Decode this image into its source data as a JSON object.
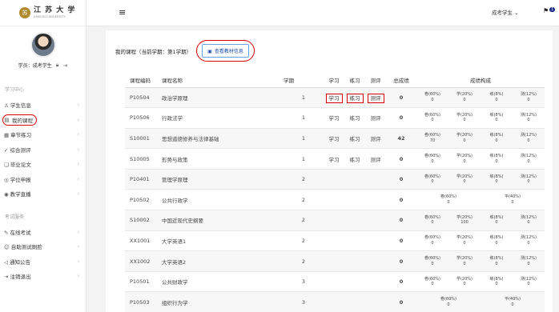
{
  "brand": {
    "logo_text": "江 苏 大 学",
    "logo_sub": "JIANGSU UNIVERSITY",
    "seal": "苏"
  },
  "profile": {
    "label": "学员：",
    "name": "成考学生"
  },
  "topbar": {
    "user": "成考学生",
    "badge": "1"
  },
  "sidebar": {
    "section1": "学习中心",
    "items1": [
      {
        "label": "学生信息",
        "icon": "user-icon"
      },
      {
        "label": "我的课程",
        "icon": "book-icon"
      },
      {
        "label": "章节练习",
        "icon": "doc-icon"
      },
      {
        "label": "综合测评",
        "icon": "check-icon"
      },
      {
        "label": "毕业论文",
        "icon": "paper-icon"
      },
      {
        "label": "学位申报",
        "icon": "degree-icon"
      },
      {
        "label": "教学直播",
        "icon": "live-icon"
      }
    ],
    "section2": "考试服务",
    "items2": [
      {
        "label": "在线考试",
        "icon": "edit-icon"
      },
      {
        "label": "自助测试刷脸",
        "icon": "face-icon"
      },
      {
        "label": "通知公告",
        "icon": "bell-icon"
      },
      {
        "label": "注销退出",
        "icon": "logout-icon"
      }
    ]
  },
  "main": {
    "title": "我的课程（当前学期：第1学期）",
    "textbook_button": "查看教材信息",
    "headers": [
      "课程编码",
      "课程名称",
      "学期",
      "学习",
      "练习",
      "测评",
      "总成绩",
      "成绩构成"
    ],
    "rows": [
      {
        "code": "P10504",
        "name": "政治学原理",
        "term": "1",
        "study": "学习",
        "practice": "练习",
        "exam": "测评",
        "total": "0",
        "scores": [
          [
            "卷(60%)",
            "0"
          ],
          [
            "学(20%)",
            "0"
          ],
          [
            "练(8%)",
            "0"
          ],
          [
            "测(12%)",
            "0"
          ]
        ]
      },
      {
        "code": "P10506",
        "name": "行政法学",
        "term": "1",
        "study": "学习",
        "practice": "练习",
        "exam": "测评",
        "total": "0",
        "scores": [
          [
            "卷(60%)",
            "0"
          ],
          [
            "学(20%)",
            "0"
          ],
          [
            "练(8%)",
            "0"
          ],
          [
            "测(12%)",
            "0"
          ]
        ]
      },
      {
        "code": "S10001",
        "name": "思想道德修养与法律基础",
        "term": "1",
        "study": "学习",
        "practice": "练习",
        "exam": "测评",
        "total": "42",
        "scores": [
          [
            "卷(60%)",
            "70"
          ],
          [
            "学(20%)",
            "0"
          ],
          [
            "练(8%)",
            "0"
          ],
          [
            "测(12%)",
            "0"
          ]
        ]
      },
      {
        "code": "S10005",
        "name": "形势与政策",
        "term": "1",
        "study": "学习",
        "practice": "练习",
        "exam": "测评",
        "total": "0",
        "scores": [
          [
            "卷(60%)",
            "0"
          ],
          [
            "学(20%)",
            "0"
          ],
          [
            "练(8%)",
            "0"
          ],
          [
            "测(12%)",
            "0"
          ]
        ]
      },
      {
        "code": "P10401",
        "name": "管理学原理",
        "term": "2",
        "study": "",
        "practice": "",
        "exam": "",
        "total": "0",
        "scores": [
          [
            "卷(60%)",
            "0"
          ],
          [
            "学(20%)",
            "0"
          ],
          [
            "练(8%)",
            "0"
          ],
          [
            "测(12%)",
            "0"
          ]
        ]
      },
      {
        "code": "P10502",
        "name": "公共行政学",
        "term": "2",
        "study": "",
        "practice": "",
        "exam": "",
        "total": "0",
        "scores": [
          [
            "卷(60%)",
            "0"
          ],
          [
            "平(40%)",
            "0"
          ]
        ]
      },
      {
        "code": "S10002",
        "name": "中国近现代史纲要",
        "term": "2",
        "study": "",
        "practice": "",
        "exam": "",
        "total": "0",
        "scores": [
          [
            "卷(60%)",
            "0"
          ],
          [
            "学(20%)",
            "100"
          ],
          [
            "练(8%)",
            "0"
          ],
          [
            "测(12%)",
            "0"
          ]
        ]
      },
      {
        "code": "XX1001",
        "name": "大学英语1",
        "term": "2",
        "study": "",
        "practice": "",
        "exam": "",
        "total": "0",
        "scores": [
          [
            "卷(60%)",
            "0"
          ],
          [
            "学(20%)",
            "0"
          ],
          [
            "练(8%)",
            "0"
          ],
          [
            "测(12%)",
            "0"
          ]
        ]
      },
      {
        "code": "XX1002",
        "name": "大学英语2",
        "term": "2",
        "study": "",
        "practice": "",
        "exam": "",
        "total": "0",
        "scores": [
          [
            "卷(60%)",
            "0"
          ],
          [
            "学(20%)",
            "0"
          ],
          [
            "练(8%)",
            "0"
          ],
          [
            "测(12%)",
            "0"
          ]
        ]
      },
      {
        "code": "P10501",
        "name": "公共财政学",
        "term": "3",
        "study": "",
        "practice": "",
        "exam": "",
        "total": "0",
        "scores": [
          [
            "卷(60%)",
            "0"
          ],
          [
            "学(20%)",
            "0"
          ],
          [
            "练(8%)",
            "0"
          ],
          [
            "测(12%)",
            "0"
          ]
        ]
      },
      {
        "code": "P10503",
        "name": "组织行为学",
        "term": "3",
        "study": "",
        "practice": "",
        "exam": "",
        "total": "0",
        "scores": [
          [
            "卷(60%)",
            "0"
          ],
          [
            "平(40%)",
            "0"
          ]
        ]
      }
    ]
  },
  "colors": {
    "link": "#3d7ad6",
    "total": "#1a2b8a",
    "highlight": "#dd0000"
  }
}
